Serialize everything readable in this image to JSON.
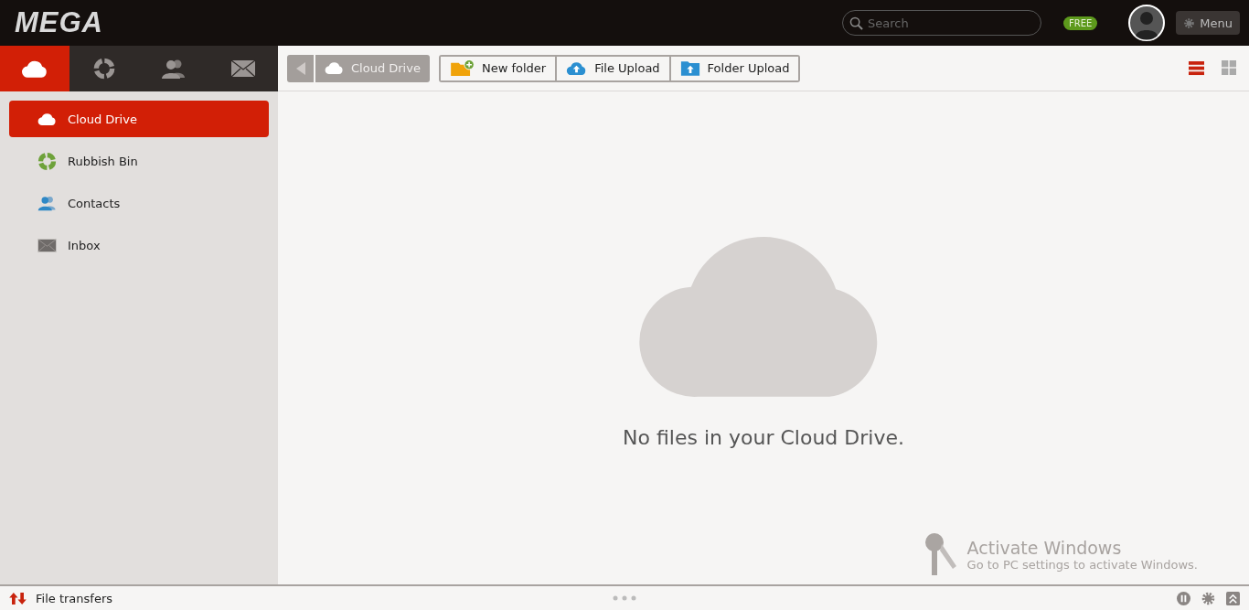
{
  "header": {
    "logo": "MEGA",
    "search": {
      "placeholder": "Search"
    },
    "plan_badge": "FREE",
    "menu_button": "Menu"
  },
  "nav_tabs": [
    {
      "kind": "cloud",
      "selected": true
    },
    {
      "kind": "bin",
      "selected": false
    },
    {
      "kind": "contacts",
      "selected": false
    },
    {
      "kind": "inbox",
      "selected": false
    }
  ],
  "sidebar": {
    "items": [
      {
        "kind": "cloud",
        "label": "Cloud Drive",
        "selected": true
      },
      {
        "kind": "bin",
        "label": "Rubbish Bin",
        "selected": false
      },
      {
        "kind": "contacts",
        "label": "Contacts",
        "selected": false
      },
      {
        "kind": "inbox",
        "label": "Inbox",
        "selected": false
      }
    ]
  },
  "breadcrumb": {
    "label": "Cloud Drive"
  },
  "toolbar": {
    "buttons": [
      {
        "kind": "new-folder",
        "label": "New folder"
      },
      {
        "kind": "file-upload",
        "label": "File Upload"
      },
      {
        "kind": "folder-upload",
        "label": "Folder Upload"
      }
    ],
    "views": [
      {
        "kind": "list",
        "selected": true
      },
      {
        "kind": "grid",
        "selected": false
      }
    ]
  },
  "empty_state": {
    "message": "No files in your Cloud Drive."
  },
  "activation_notice": {
    "title": "Activate Windows",
    "message": "Go to PC settings to activate Windows."
  },
  "status_bar": {
    "label": "File transfers"
  }
}
